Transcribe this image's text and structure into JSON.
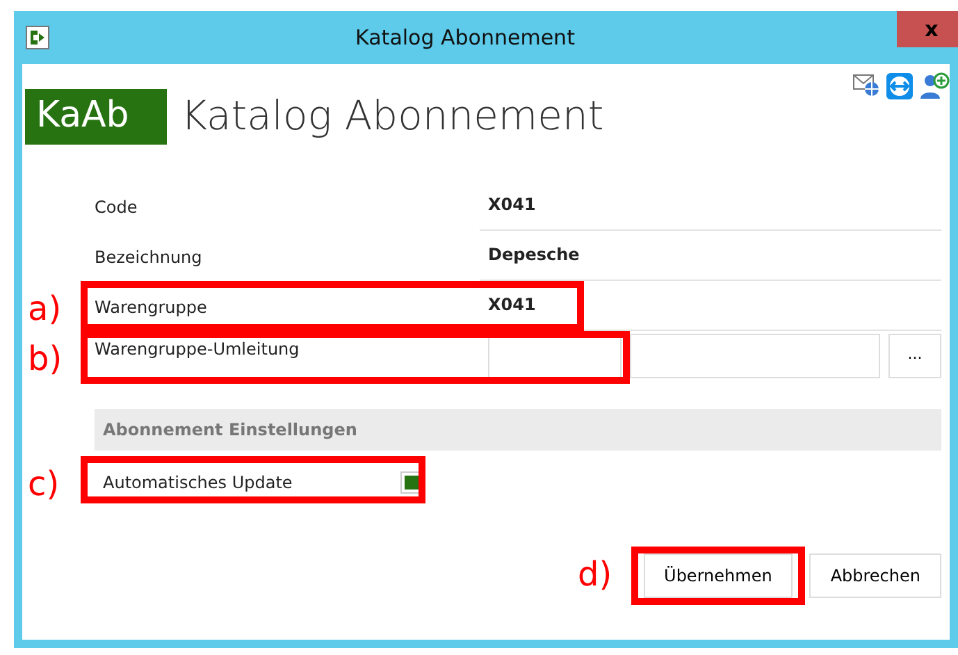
{
  "window": {
    "title": "Katalog Abonnement",
    "close": "x"
  },
  "header": {
    "badge": "KaAb",
    "title": "Katalog Abonnement"
  },
  "fields": [
    {
      "kind": "text",
      "label": "Code",
      "value": "X041"
    },
    {
      "kind": "text",
      "label": "Bezeichnung",
      "value": "Depesche"
    },
    {
      "kind": "text",
      "label": "Warengruppe",
      "value": "X041"
    },
    {
      "kind": "lookup",
      "label": "Warengruppe-Umleitung",
      "browse": "..."
    }
  ],
  "section": {
    "title": "Abonnement Einstellungen",
    "options": [
      {
        "kind": "checkbox",
        "label": "Automatisches Update",
        "checked": true
      }
    ]
  },
  "buttons": [
    {
      "label": "Übernehmen"
    },
    {
      "label": "Abbrechen"
    }
  ],
  "annotations": [
    {
      "label": "a)"
    },
    {
      "label": "b)"
    },
    {
      "label": "c)"
    },
    {
      "label": "d)"
    }
  ]
}
